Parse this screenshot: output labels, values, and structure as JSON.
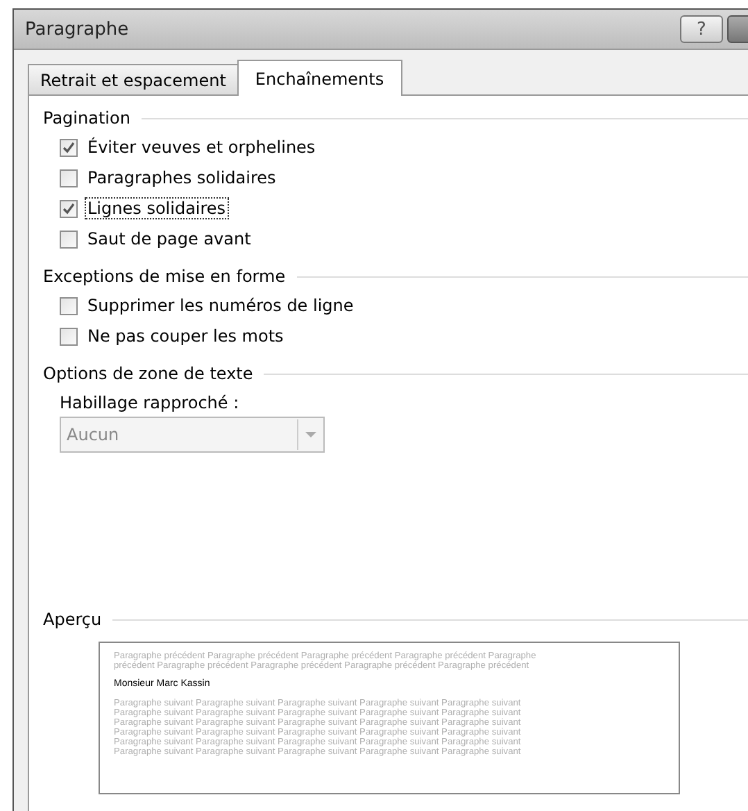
{
  "window": {
    "title": "Paragraphe",
    "help_button": "?"
  },
  "tabs": [
    {
      "label": "Retrait et espacement",
      "selected": false
    },
    {
      "label": "Enchaînements",
      "selected": true
    }
  ],
  "sections": [
    {
      "title": "Pagination",
      "options": [
        {
          "label": "Éviter veuves et orphelines",
          "checked": true,
          "focused": false
        },
        {
          "label": "Paragraphes solidaires",
          "checked": false,
          "focused": false
        },
        {
          "label": "Lignes solidaires",
          "checked": true,
          "focused": true
        },
        {
          "label": "Saut de page avant",
          "checked": false,
          "focused": false
        }
      ]
    },
    {
      "title": "Exceptions de mise en forme",
      "options": [
        {
          "label": "Supprimer les numéros de ligne",
          "checked": false,
          "focused": false
        },
        {
          "label": "Ne pas couper les mots",
          "checked": false,
          "focused": false
        }
      ]
    },
    {
      "title": "Options de zone de texte",
      "dropdown": {
        "label": "Habillage rapproché :",
        "value": "Aucun",
        "disabled": true
      }
    }
  ],
  "preview": {
    "title": "Aperçu",
    "previous_lines": [
      "Paragraphe précédent Paragraphe précédent Paragraphe précédent Paragraphe précédent Paragraphe",
      "précédent Paragraphe précédent Paragraphe précédent Paragraphe précédent Paragraphe précédent"
    ],
    "current_text": "Monsieur Marc Kassin",
    "next_lines": [
      "Paragraphe suivant Paragraphe suivant Paragraphe suivant Paragraphe suivant Paragraphe suivant",
      "Paragraphe suivant Paragraphe suivant Paragraphe suivant Paragraphe suivant Paragraphe suivant",
      "Paragraphe suivant Paragraphe suivant Paragraphe suivant Paragraphe suivant Paragraphe suivant",
      "Paragraphe suivant Paragraphe suivant Paragraphe suivant Paragraphe suivant Paragraphe suivant",
      "Paragraphe suivant Paragraphe suivant Paragraphe suivant Paragraphe suivant Paragraphe suivant",
      "Paragraphe suivant Paragraphe suivant Paragraphe suivant Paragraphe suivant Paragraphe suivant"
    ]
  }
}
